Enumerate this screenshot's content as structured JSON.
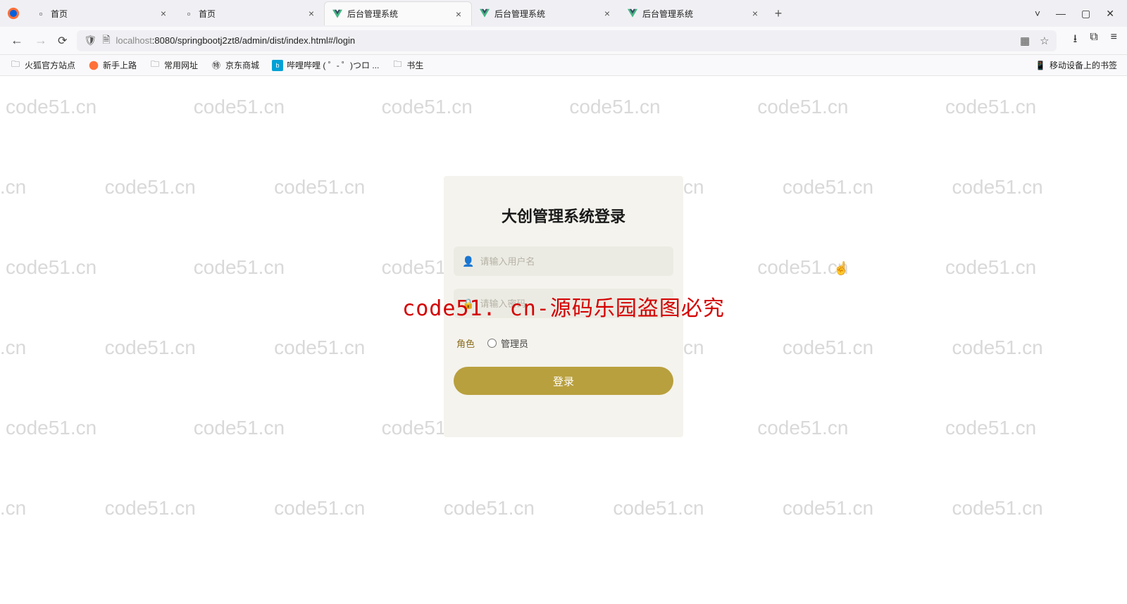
{
  "tabs": [
    {
      "title": "首页",
      "favicon": "generic"
    },
    {
      "title": "首页",
      "favicon": "generic"
    },
    {
      "title": "后台管理系统",
      "favicon": "vue",
      "active": true
    },
    {
      "title": "后台管理系统",
      "favicon": "vue"
    },
    {
      "title": "后台管理系统",
      "favicon": "vue"
    }
  ],
  "address": {
    "host": "localhost",
    "path": ":8080/springbootj2zt8/admin/dist/index.html#/login"
  },
  "bookmarks": [
    {
      "label": "火狐官方站点",
      "icon": "folder"
    },
    {
      "label": "新手上路",
      "icon": "firefox"
    },
    {
      "label": "常用网址",
      "icon": "folder"
    },
    {
      "label": "京东商城",
      "icon": "jd"
    },
    {
      "label": "哔哩哔哩 (  ゜- ゜)つロ ...",
      "icon": "bili"
    },
    {
      "label": "书生",
      "icon": "folder"
    }
  ],
  "bookmark_right": "移动设备上的书签",
  "login": {
    "title": "大创管理系统登录",
    "username_placeholder": "请输入用户名",
    "password_placeholder": "请输入密码",
    "role_label": "角色",
    "role_option": "管理员",
    "button": "登录"
  },
  "watermark_text": "code51.cn",
  "center_watermark": "code51. cn-源码乐园盗图必究"
}
